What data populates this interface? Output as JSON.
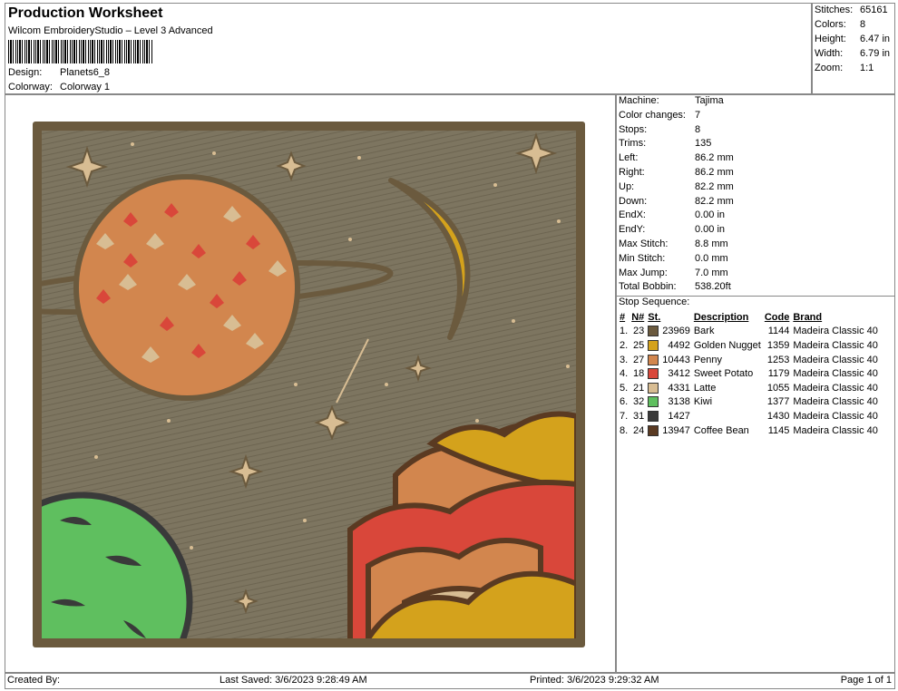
{
  "header": {
    "title": "Production Worksheet",
    "subtitle": "Wilcom EmbroideryStudio – Level 3 Advanced",
    "design_label": "Design:",
    "design_value": "Planets6_8",
    "colorway_label": "Colorway:",
    "colorway_value": "Colorway 1"
  },
  "stats": [
    {
      "label": "Stitches:",
      "value": "65161"
    },
    {
      "label": "Colors:",
      "value": "8"
    },
    {
      "label": "Height:",
      "value": "6.47 in"
    },
    {
      "label": "Width:",
      "value": "6.79 in"
    },
    {
      "label": "Zoom:",
      "value": "1:1"
    }
  ],
  "info": [
    {
      "label": "Machine:",
      "value": "Tajima"
    },
    {
      "label": "Color changes:",
      "value": "7"
    },
    {
      "label": "Stops:",
      "value": "8"
    },
    {
      "label": "Trims:",
      "value": "135"
    },
    {
      "label": "Left:",
      "value": "86.2 mm"
    },
    {
      "label": "Right:",
      "value": "86.2 mm"
    },
    {
      "label": "Up:",
      "value": "82.2 mm"
    },
    {
      "label": "Down:",
      "value": "82.2 mm"
    },
    {
      "label": "EndX:",
      "value": "0.00 in"
    },
    {
      "label": "EndY:",
      "value": "0.00 in"
    },
    {
      "label": "Max Stitch:",
      "value": "8.8 mm"
    },
    {
      "label": "Min Stitch:",
      "value": "0.0 mm"
    },
    {
      "label": "Max Jump:",
      "value": "7.0 mm"
    },
    {
      "label": "Total Bobbin:",
      "value": "538.20ft"
    }
  ],
  "stop_sequence": {
    "title": "Stop Sequence:",
    "headers": {
      "num": "#",
      "n": "N#",
      "st": "St.",
      "desc": "Description",
      "code": "Code",
      "brand": "Brand"
    },
    "rows": [
      {
        "num": "1.",
        "n": "23",
        "color": "#6b5a3e",
        "st": "23969",
        "desc": "Bark",
        "code": "1144",
        "brand": "Madeira Classic 40"
      },
      {
        "num": "2.",
        "n": "25",
        "color": "#d4a21c",
        "st": "4492",
        "desc": "Golden Nugget",
        "code": "1359",
        "brand": "Madeira Classic 40"
      },
      {
        "num": "3.",
        "n": "27",
        "color": "#d2864e",
        "st": "10443",
        "desc": "Penny",
        "code": "1253",
        "brand": "Madeira Classic 40"
      },
      {
        "num": "4.",
        "n": "18",
        "color": "#d9473a",
        "st": "3412",
        "desc": "Sweet Potato",
        "code": "1179",
        "brand": "Madeira Classic 40"
      },
      {
        "num": "5.",
        "n": "21",
        "color": "#d8bd93",
        "st": "4331",
        "desc": "Latte",
        "code": "1055",
        "brand": "Madeira Classic 40"
      },
      {
        "num": "6.",
        "n": "32",
        "color": "#5fbf5f",
        "st": "3138",
        "desc": "Kiwi",
        "code": "1377",
        "brand": "Madeira Classic 40"
      },
      {
        "num": "7.",
        "n": "31",
        "color": "#3a3a3a",
        "st": "1427",
        "desc": "",
        "code": "1430",
        "brand": "Madeira Classic 40"
      },
      {
        "num": "8.",
        "n": "24",
        "color": "#5a3a22",
        "st": "13947",
        "desc": "Coffee Bean",
        "code": "1145",
        "brand": "Madeira Classic 40"
      }
    ]
  },
  "footer": {
    "created_by": "Created By:",
    "last_saved": "Last Saved: 3/6/2023 9:28:49 AM",
    "printed": "Printed: 3/6/2023 9:29:32 AM",
    "page": "Page 1 of 1"
  }
}
